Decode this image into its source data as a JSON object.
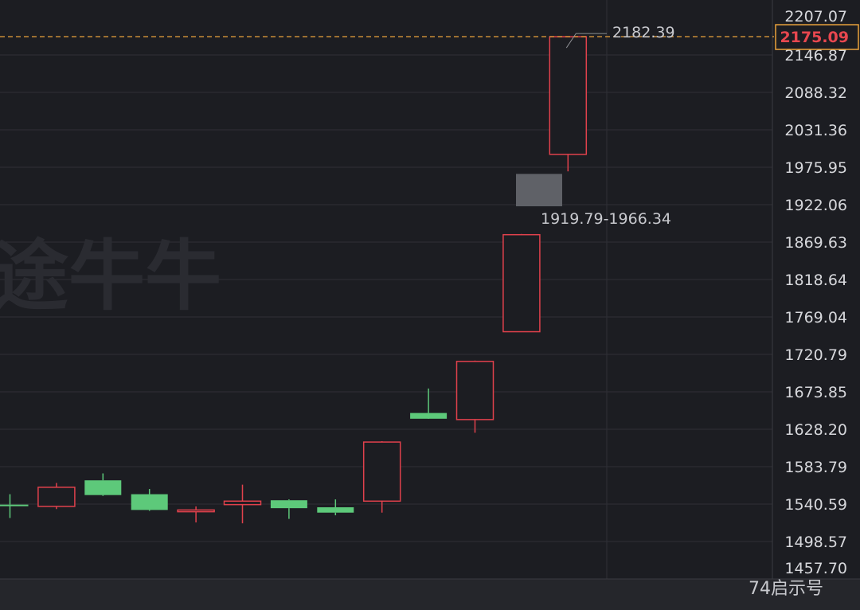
{
  "chart_data": {
    "type": "candlestick",
    "y_ticks": [
      "2207.07",
      "2146.87",
      "2088.32",
      "2031.36",
      "1975.95",
      "1922.06",
      "1869.63",
      "1818.64",
      "1769.04",
      "1720.79",
      "1673.85",
      "1628.20",
      "1583.79",
      "1540.59",
      "1498.57",
      "1457.70"
    ],
    "ylim": [
      1457.7,
      2207.07
    ],
    "grid": true,
    "candles": [
      {
        "open": 1540,
        "high": 1552,
        "low": 1525,
        "close": 1539
      },
      {
        "open": 1538,
        "high": 1565,
        "low": 1535,
        "close": 1560
      },
      {
        "open": 1568,
        "high": 1576,
        "low": 1550,
        "close": 1551
      },
      {
        "open": 1552,
        "high": 1558,
        "low": 1533,
        "close": 1534
      },
      {
        "open": 1532,
        "high": 1538,
        "low": 1520,
        "close": 1534
      },
      {
        "open": 1540,
        "high": 1563,
        "low": 1519,
        "close": 1544
      },
      {
        "open": 1545,
        "high": 1546,
        "low": 1524,
        "close": 1536
      },
      {
        "open": 1537,
        "high": 1546,
        "low": 1528,
        "close": 1531
      },
      {
        "open": 1544,
        "high": 1614,
        "low": 1531,
        "close": 1613
      },
      {
        "open": 1648,
        "high": 1678,
        "low": 1642,
        "close": 1641
      },
      {
        "open": 1640,
        "high": 1713,
        "low": 1624,
        "close": 1712
      },
      {
        "open": 1750,
        "high": 1881,
        "low": 1750,
        "close": 1880
      },
      {
        "open": 1995,
        "high": 2175,
        "low": 1970,
        "close": 2175
      }
    ],
    "gap_zone": {
      "low": 1919.79,
      "high": 1966.34,
      "label": "1919.79-1966.34"
    },
    "high_marker": {
      "value": 2182.39,
      "label": "2182.39"
    },
    "last_price": {
      "value": 2175.09,
      "label": "2175.09"
    }
  },
  "watermark": "途牛牛",
  "corner_watermark": "74启示号",
  "colors": {
    "up": "#e0414c",
    "down": "#5dc97a",
    "grid": "#2f3036",
    "gap": "#5f6167",
    "last_price_line": "#e9a23b",
    "last_price_text": "#e8474f",
    "axis_text": "#d7d8dc"
  }
}
